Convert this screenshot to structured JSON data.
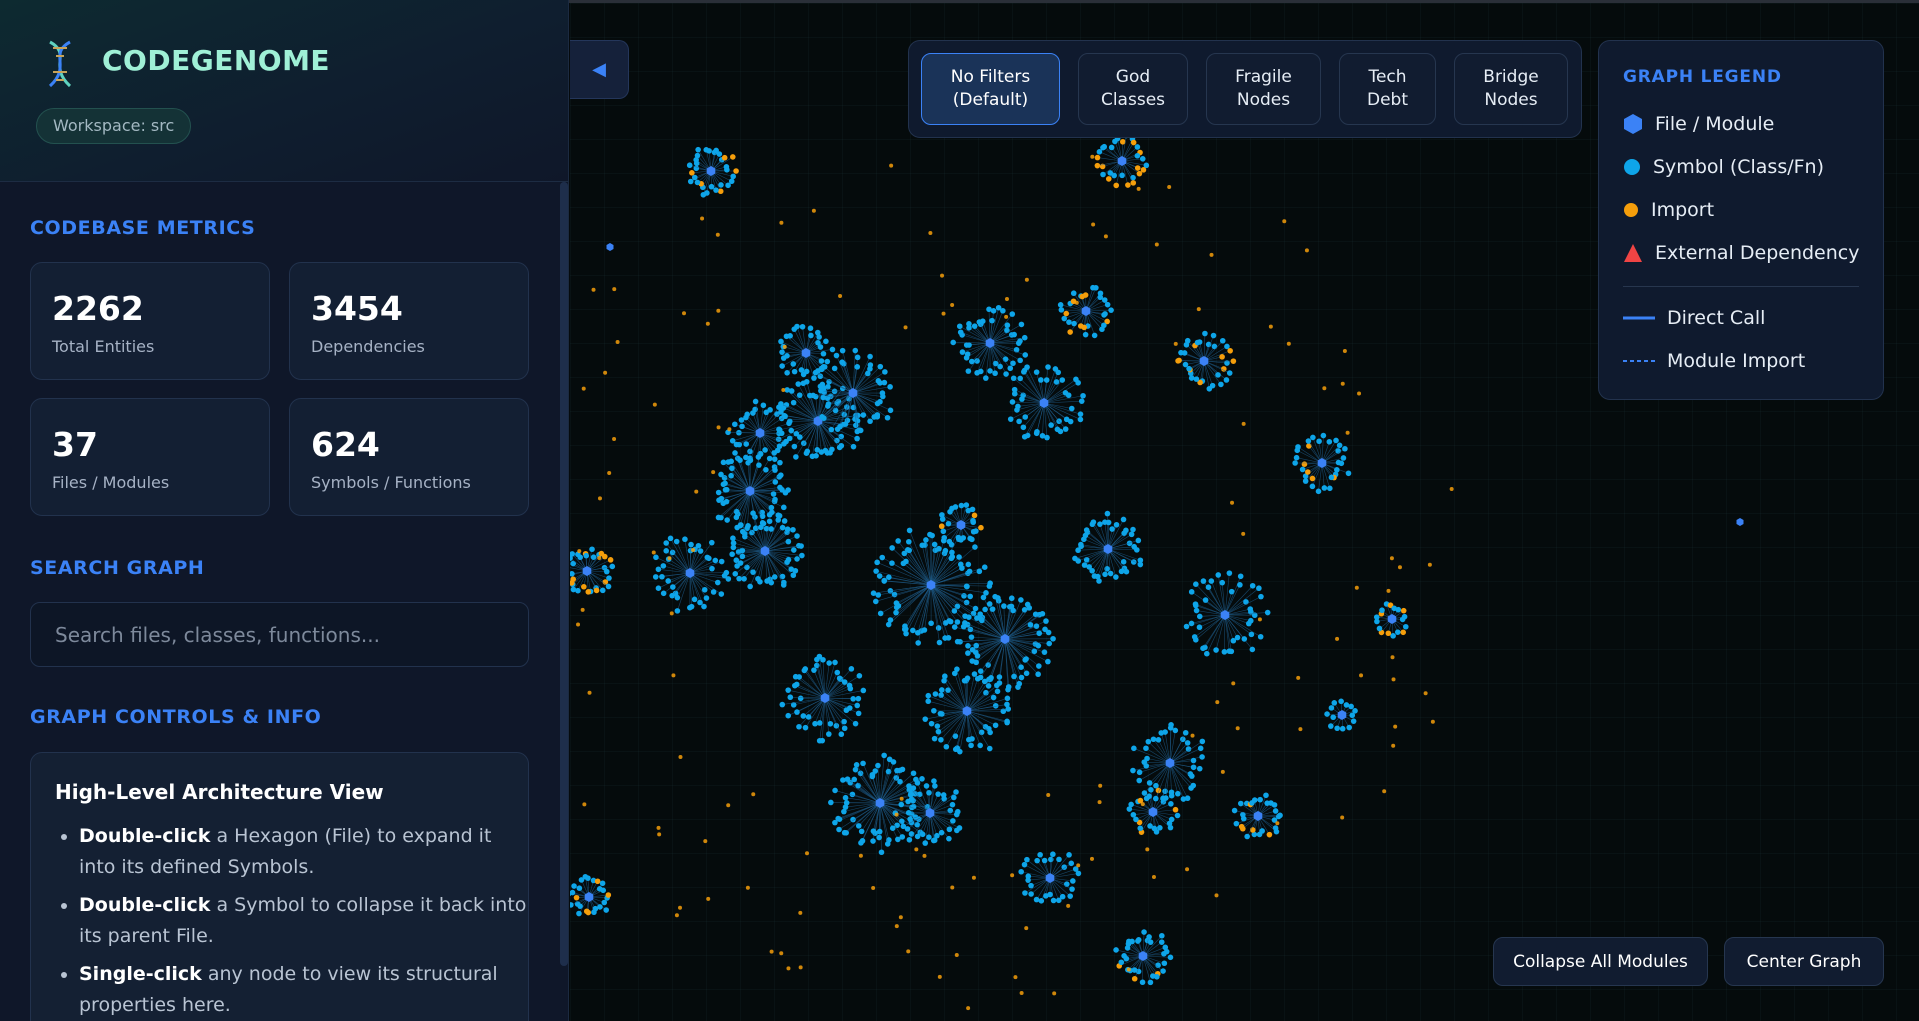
{
  "app": {
    "title": "CODEGENOME",
    "workspace": "Workspace: src",
    "logo_icon": "dna-helix-icon"
  },
  "metrics": {
    "section_title": "CODEBASE METRICS",
    "cards": [
      {
        "value": "2262",
        "label": "Total Entities"
      },
      {
        "value": "3454",
        "label": "Dependencies"
      },
      {
        "value": "37",
        "label": "Files / Modules"
      },
      {
        "value": "624",
        "label": "Symbols / Functions"
      }
    ]
  },
  "search": {
    "section_title": "SEARCH GRAPH",
    "placeholder": "Search files, classes, functions...",
    "value": ""
  },
  "controls": {
    "section_title": "GRAPH CONTROLS & INFO",
    "info_title": "High-Level Architecture View",
    "items": [
      {
        "bold": "Double-click",
        "text": " a Hexagon (File) to expand it into its defined Symbols."
      },
      {
        "bold": "Double-click",
        "text": " a Symbol to collapse it back into its parent File."
      },
      {
        "bold": "Single-click",
        "text": " any node to view its structural properties here."
      }
    ]
  },
  "sidebar_toggle": {
    "icon": "chevron-left-icon",
    "glyph": "◀"
  },
  "filters": [
    {
      "label": "No Filters\n(Default)",
      "active": true
    },
    {
      "label": "God\nClasses",
      "active": false
    },
    {
      "label": "Fragile\nNodes",
      "active": false
    },
    {
      "label": "Tech\nDebt",
      "active": false
    },
    {
      "label": "Bridge\nNodes",
      "active": false
    }
  ],
  "legend": {
    "title": "GRAPH LEGEND",
    "items": [
      {
        "label": "File / Module",
        "icon": "hexagon-icon",
        "color": "#3b82f6"
      },
      {
        "label": "Symbol (Class/Fn)",
        "icon": "circle-icon",
        "color": "#0ea5e9"
      },
      {
        "label": "Import",
        "icon": "circle-icon",
        "color": "#f59e0b"
      },
      {
        "label": "External Dependency",
        "icon": "triangle-icon",
        "color": "#ef4444"
      },
      {
        "label": "Direct Call",
        "icon": "solid-line-icon",
        "color": "#3b82f6"
      },
      {
        "label": "Module Import",
        "icon": "dashed-line-icon",
        "color": "#3b82f6"
      }
    ]
  },
  "actions": {
    "collapse_all": "Collapse All Modules",
    "center_graph": "Center Graph"
  },
  "colors": {
    "accent": "#3b82f6",
    "symbol": "#0ea5e9",
    "import": "#f59e0b",
    "external": "#ef4444",
    "brand": "#9ff0d6"
  }
}
